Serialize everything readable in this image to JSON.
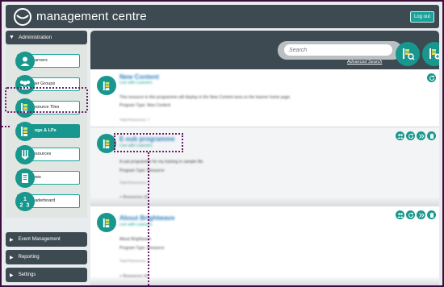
{
  "app": {
    "title": "management centre",
    "logout_label": "Log out"
  },
  "sidebar": {
    "header": "Administration",
    "items": [
      {
        "label": "Learners",
        "icon": "person-icon"
      },
      {
        "label": "User Groups",
        "icon": "group-icon"
      },
      {
        "label": "Resource Tiles",
        "icon": "resource-tiles-icon"
      },
      {
        "label": "Progs & LPs",
        "icon": "programme-icon",
        "active": true
      },
      {
        "label": "Resources",
        "icon": "resources-icon"
      },
      {
        "label": "News",
        "icon": "news-icon"
      },
      {
        "label": "Leaderboard",
        "icon": "leaderboard-icon"
      }
    ],
    "sections": [
      "Event Management",
      "Reporting",
      "Settings"
    ]
  },
  "main": {
    "search_placeholder": "Search",
    "advanced_search": "Advanced Search",
    "cards": [
      {
        "title": "New Content",
        "subtitle": "Live with Learners",
        "lines": [
          "This resource in this programme will display in the New Content area on the learner home page.",
          "Program Type: New Content"
        ],
        "muted": "Total Resources: 7"
      },
      {
        "title": "E-sub programme",
        "subtitle": "Live with Learners",
        "lines": [
          "A sub programme for my training in sample file.",
          "Program Type: Resource"
        ],
        "muted": "Total Resources: 3",
        "more": "+ Resources (3)"
      },
      {
        "title": "About Brightwave",
        "subtitle": "Live with Learners",
        "lines": [
          "About Brightwave",
          "Program Type: Resource"
        ],
        "muted": "Total Resources: 4",
        "more": "+ Resources (4)"
      }
    ]
  },
  "colors": {
    "accent": "#17978d",
    "dark": "#3e4a52",
    "highlight": "#6b1b66"
  }
}
